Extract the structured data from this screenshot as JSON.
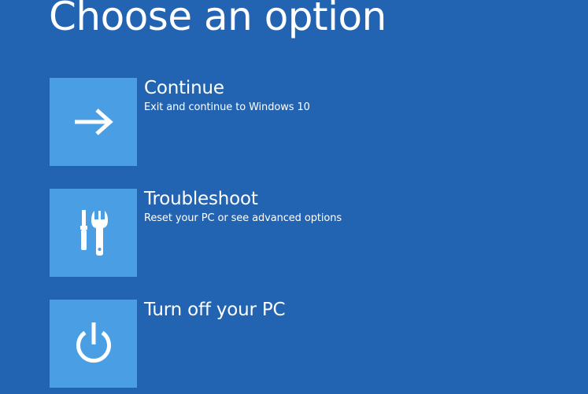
{
  "page": {
    "title": "Choose an option",
    "background_color": "#2264b1",
    "tile_color": "#4a9ee3"
  },
  "options": [
    {
      "title": "Continue",
      "description": "Exit and continue to Windows 10",
      "icon": "arrow-right-icon"
    },
    {
      "title": "Troubleshoot",
      "description": "Reset your PC or see advanced options",
      "icon": "tools-icon"
    },
    {
      "title": "Turn off your PC",
      "description": "",
      "icon": "power-icon"
    }
  ]
}
